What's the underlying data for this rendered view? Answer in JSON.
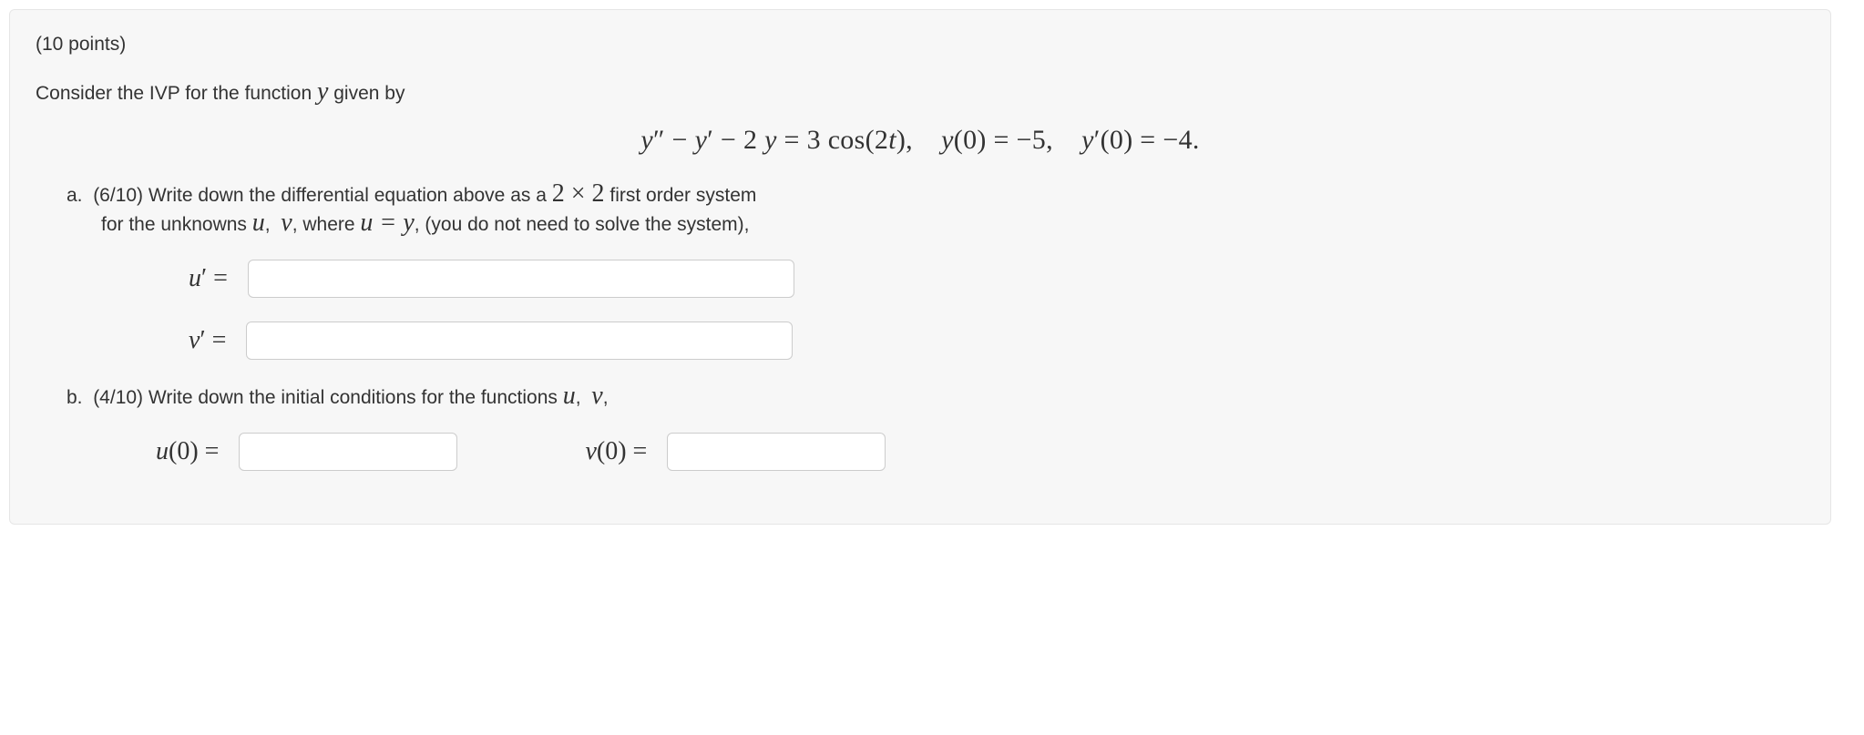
{
  "points": "(10 points)",
  "intro_pre": "Consider the IVP for the function ",
  "intro_var": "y",
  "intro_post": " given by",
  "equation": "y″ −  y′ − 2 y = 3 cos(2t),    y(0) = −5,    y′(0) = −4.",
  "parts": {
    "a": {
      "label": "a.",
      "t1": "(6/10) Write down the differential equation above as a ",
      "dim": "2 × 2",
      "t2": " first order system",
      "t3": "for the unknowns ",
      "v1": "u",
      "comma1": ", ",
      "v2": "v",
      "t4": ", where ",
      "eq": "u = y",
      "t5": ", (you do not need to solve the system),",
      "rows": {
        "u": "u′ =",
        "v": "v′ ="
      }
    },
    "b": {
      "label": "b.",
      "t1": "(4/10) Write down the initial conditions for the functions ",
      "v1": "u",
      "comma1": ", ",
      "v2": "v",
      "t2": ",",
      "rows": {
        "u0": "u(0) =",
        "v0": "v(0) ="
      }
    }
  }
}
